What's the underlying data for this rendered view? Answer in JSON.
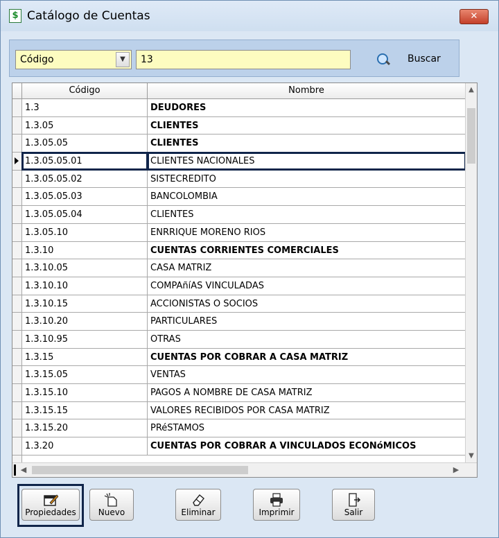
{
  "window": {
    "title": "Catálogo de Cuentas",
    "close_label": "✕"
  },
  "search": {
    "field_selected": "Código",
    "query_value": "13",
    "button_label": "Buscar"
  },
  "grid": {
    "columns": [
      "Código",
      "Nombre"
    ],
    "rows": [
      {
        "code": "1.3",
        "name": "DEUDORES",
        "bold": true
      },
      {
        "code": "1.3.05",
        "name": "CLIENTES",
        "bold": true
      },
      {
        "code": "1.3.05.05",
        "name": "CLIENTES",
        "bold": true
      },
      {
        "code": "1.3.05.05.01",
        "name": "CLIENTES NACIONALES",
        "bold": false,
        "selected": true
      },
      {
        "code": "1.3.05.05.02",
        "name": "SISTECREDITO",
        "bold": false
      },
      {
        "code": "1.3.05.05.03",
        "name": "BANCOLOMBIA",
        "bold": false
      },
      {
        "code": "1.3.05.05.04",
        "name": "CLIENTES",
        "bold": false
      },
      {
        "code": "1.3.05.10",
        "name": "ENRRIQUE MORENO RIOS",
        "bold": false
      },
      {
        "code": "1.3.10",
        "name": "CUENTAS CORRIENTES COMERCIALES",
        "bold": true
      },
      {
        "code": "1.3.10.05",
        "name": "CASA MATRIZ",
        "bold": false
      },
      {
        "code": "1.3.10.10",
        "name": "COMPAñíAS VINCULADAS",
        "bold": false
      },
      {
        "code": "1.3.10.15",
        "name": "ACCIONISTAS O SOCIOS",
        "bold": false
      },
      {
        "code": "1.3.10.20",
        "name": "PARTICULARES",
        "bold": false
      },
      {
        "code": "1.3.10.95",
        "name": "OTRAS",
        "bold": false
      },
      {
        "code": "1.3.15",
        "name": "CUENTAS POR COBRAR A CASA MATRIZ",
        "bold": true
      },
      {
        "code": "1.3.15.05",
        "name": "VENTAS",
        "bold": false
      },
      {
        "code": "1.3.15.10",
        "name": "PAGOS A NOMBRE DE CASA MATRIZ",
        "bold": false
      },
      {
        "code": "1.3.15.15",
        "name": "VALORES RECIBIDOS POR CASA MATRIZ",
        "bold": false
      },
      {
        "code": "1.3.15.20",
        "name": "PRéSTAMOS",
        "bold": false
      },
      {
        "code": "1.3.20",
        "name": "CUENTAS POR COBRAR A VINCULADOS ECONóMICOS",
        "bold": true
      }
    ]
  },
  "toolbar": {
    "propiedades": "Propiedades",
    "nuevo": "Nuevo",
    "eliminar": "Eliminar",
    "imprimir": "Imprimir",
    "salir": "Salir"
  },
  "icons": [
    "catalog-icon",
    "search-icon",
    "properties-icon",
    "new-icon",
    "eraser-icon",
    "printer-icon",
    "exit-icon"
  ]
}
